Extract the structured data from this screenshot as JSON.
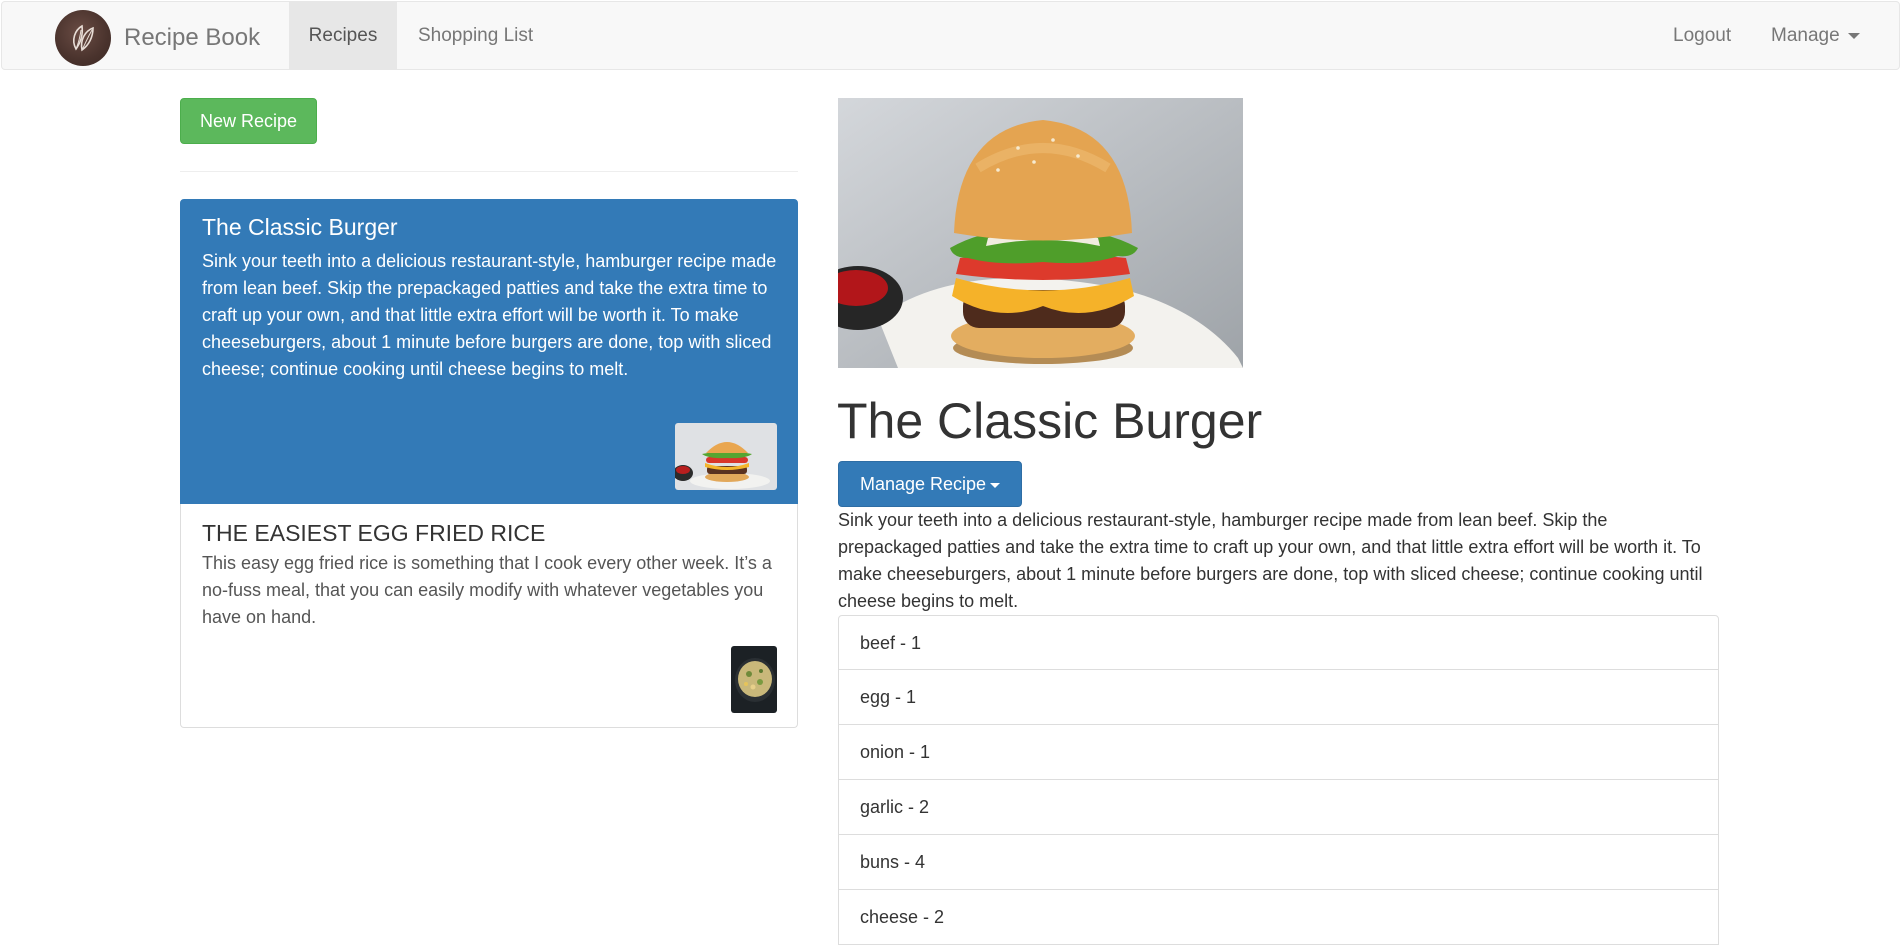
{
  "navbar": {
    "brand": "Recipe Book",
    "links": [
      {
        "label": "Recipes",
        "active": true
      },
      {
        "label": "Shopping List",
        "active": false
      }
    ],
    "right": {
      "logout": "Logout",
      "manage": "Manage"
    }
  },
  "sidebar": {
    "new_recipe_label": "New Recipe",
    "recipes": [
      {
        "title": "The Classic Burger",
        "description": "Sink your teeth into a delicious restaurant-style, hamburger recipe made from lean beef. Skip the prepackaged patties and take the extra time to craft up your own, and that little extra effort will be worth it. To make cheeseburgers, about 1 minute before burgers are done, top with sliced cheese; continue cooking until cheese begins to melt.",
        "active": true,
        "thumbnail": "burger"
      },
      {
        "title": "THE EASIEST EGG FRIED RICE",
        "description": "This easy egg fried rice is something that I cook every other week. It’s a no-fuss meal, that you can easily modify with whatever vegetables you have on hand.",
        "active": false,
        "thumbnail": "fried-rice"
      }
    ]
  },
  "detail": {
    "title": "The Classic Burger",
    "manage_label": "Manage Recipe",
    "description": "Sink your teeth into a delicious restaurant-style, hamburger recipe made from lean beef. Skip the prepackaged patties and take the extra time to craft up your own, and that little extra effort will be worth it. To make cheeseburgers, about 1 minute before burgers are done, top with sliced cheese; continue cooking until cheese begins to melt.",
    "ingredients": [
      "beef - 1",
      "egg - 1",
      "onion - 1",
      "garlic - 2",
      "buns - 4",
      "cheese - 2"
    ]
  },
  "colors": {
    "primary": "#337ab7",
    "success": "#5cb85c",
    "navbar_bg": "#f8f8f8"
  }
}
